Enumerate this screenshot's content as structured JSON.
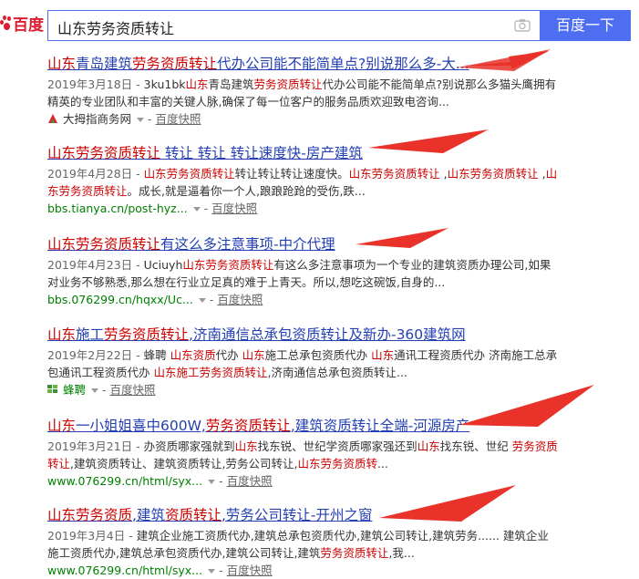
{
  "header": {
    "logo_text": "百度",
    "query": "山东劳务资质转让",
    "button_label": "百度一下"
  },
  "results": [
    {
      "title": [
        [
          "山东",
          1
        ],
        [
          "青岛建筑",
          0
        ],
        [
          "劳务资质转让",
          1
        ],
        [
          "代办公司能不能简单点?别说那么多-大...",
          0
        ]
      ],
      "abstract": [
        [
          "2019年3月18日 - ",
          2
        ],
        [
          "3ku1bk",
          0
        ],
        [
          "山东",
          1
        ],
        [
          "青岛建筑",
          0
        ],
        [
          "劳务资质转让",
          1
        ],
        [
          "代办公司能不能简单点?别说那么多猫头鹰拥有精英的专业团队和丰富的关键人脉,确保了每一位客户的服务品质欢迎致电咨询...",
          0
        ]
      ],
      "source_name": "大拇指商务网",
      "cache": "百度快照"
    },
    {
      "title": [
        [
          "山东劳务资质转让",
          1
        ],
        [
          " 转让 转让 转让速度快-房产建筑",
          0
        ]
      ],
      "abstract": [
        [
          "2019年4月28日 - ",
          2
        ],
        [
          "山东劳务资质转让",
          1
        ],
        [
          "转让转让转让速度快。",
          0
        ],
        [
          "山东劳务资质转让",
          1
        ],
        [
          " ,",
          0
        ],
        [
          "山东劳务资质转让",
          1
        ],
        [
          " ,",
          0
        ],
        [
          "山东劳务资质转让",
          1
        ],
        [
          "。成长,就是逼着你一个人,踉踉跄跄的受伤,跌...",
          0
        ]
      ],
      "url": "bbs.tianya.cn/post-hyz...",
      "cache": "百度快照"
    },
    {
      "title": [
        [
          "山东劳务资质转让",
          1
        ],
        [
          "有这么多注意事项-中介代理",
          0
        ]
      ],
      "abstract": [
        [
          "2019年4月23日 - ",
          2
        ],
        [
          "Uciuyh",
          0
        ],
        [
          "山东劳务资质转让",
          1
        ],
        [
          "有这么多注意事项为一个专业的建筑资质办理公司,如果对业务不够熟悉,那么想在行业立足真的难于上青天。所以,想吃这碗饭,自身的...",
          0
        ]
      ],
      "url": "bbs.076299.cn/hqxx/Uc...",
      "cache": "百度快照"
    },
    {
      "title": [
        [
          "山东",
          1
        ],
        [
          "施工",
          0
        ],
        [
          "劳务资质转让",
          1
        ],
        [
          ",济南通信总承包资质转让及新办-360建筑网",
          0
        ]
      ],
      "abstract": [
        [
          "2019年2月22日 - ",
          2
        ],
        [
          "蜂聘 ",
          0
        ],
        [
          "山东资质",
          1
        ],
        [
          "代办 ",
          0
        ],
        [
          "山东",
          1
        ],
        [
          "施工总承包资质代办 ",
          0
        ],
        [
          "山东",
          1
        ],
        [
          "通讯工程资质代办 济南施工总承包通讯工程资质代办 ",
          0
        ],
        [
          "山东施工劳务资质转让",
          1
        ],
        [
          ",济南通信总承包资质转让...",
          0
        ]
      ],
      "source_name": "蜂聘",
      "cache": "百度快照"
    },
    {
      "title": [
        [
          "山东",
          1
        ],
        [
          "一小姐姐喜中600W,",
          0
        ],
        [
          "劳务资质转让",
          1
        ],
        [
          ",建筑资质转让全端-河源房产",
          0
        ]
      ],
      "abstract": [
        [
          "2019年3月21日 - ",
          2
        ],
        [
          "办资质哪家强就到",
          0
        ],
        [
          "山东",
          1
        ],
        [
          "找东锐、世纪学资质哪家强还到",
          0
        ],
        [
          "山东",
          1
        ],
        [
          "找东锐、世纪 ",
          0
        ],
        [
          "劳务资质转让",
          1
        ],
        [
          ",建筑资质转让、建筑资质转让,劳务公司转让,",
          0
        ],
        [
          "山东劳务资质转",
          1
        ],
        [
          "...",
          0
        ]
      ],
      "url": "www.076299.cn/html/syx...",
      "cache": "百度快照"
    },
    {
      "title": [
        [
          "山东劳务资质",
          1
        ],
        [
          ",建筑",
          0
        ],
        [
          "资质转让",
          1
        ],
        [
          ",劳务公司转让-开州之窗",
          0
        ]
      ],
      "abstract": [
        [
          "2019年3月4日 - ",
          2
        ],
        [
          "建筑企业施工资质代办,建筑总承包资质代办,建筑公司转让,建筑劳务...... 建筑企业施工资质代办,建筑总承包资质代办,建筑公司转让,建筑",
          0
        ],
        [
          "劳务资质转让",
          1
        ],
        [
          ",我...",
          0
        ]
      ],
      "url": "www.076299.cn/html/syx...",
      "cache": "百度快照"
    }
  ],
  "colors": {
    "brand_red": "#de1c31",
    "link_blue": "#2440b3",
    "highlight_red": "#cc0000",
    "url_green": "#008000",
    "button_blue": "#4e6ef2",
    "arrow_red": "#e8322a"
  }
}
